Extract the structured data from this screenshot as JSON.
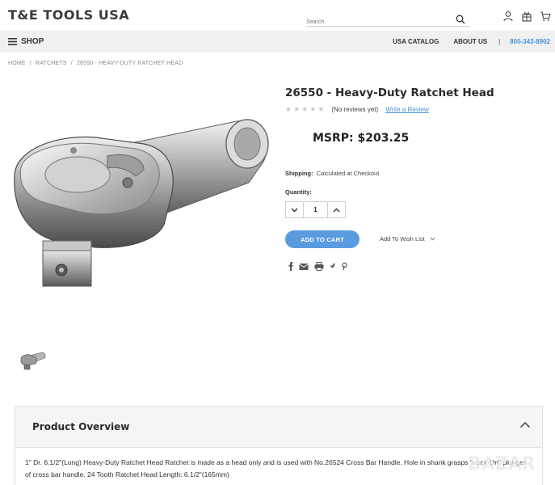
{
  "header": {
    "logo": "T&E TOOLS USA",
    "search_placeholder": "Search"
  },
  "icons": {
    "search": "search-icon",
    "account": "user-icon",
    "gift": "gift-icon",
    "cart": "cart-icon",
    "menu": "hamburger-icon"
  },
  "nav": {
    "shop_label": "SHOP",
    "links": [
      "USA CATALOG",
      "ABOUT US"
    ],
    "separator": "|",
    "phone": "800-343-8902"
  },
  "breadcrumb": [
    "HOME",
    "RATCHETS",
    "26550 - HEAVY-DUTY RATCHET HEAD"
  ],
  "breadcrumb_sep": "/",
  "product": {
    "title": "26550 - Heavy-Duty Ratchet Head",
    "reviews_text": "(No reviews yet)",
    "write_review": "Write a Review",
    "msrp": "MSRP: $203.25",
    "shipping_label": "Shipping:",
    "shipping_value": "Calculated at Checkout",
    "quantity_label": "Quantity:",
    "quantity_value": "1",
    "add_to_cart": "ADD TO CART",
    "wishlist": "Add To Wish List"
  },
  "overview": {
    "heading": "Product Overview",
    "description": "1\" Dr. 6.1/2\"(Long) Heavy-Duty Ratchet Head Ratchet is made as a head only and is used with No.26524 Cross Bar Handle. Hole in shank grasps \"Lock-On\" plunger of cross bar handle. 24 Tooth Ratchet Head Length: 6.1/2\"(165mm)"
  },
  "watermark": "BAZAR",
  "colors": {
    "accent": "#5a9be0",
    "link": "#4a90d9",
    "navbar_bg": "#f0f0f0"
  }
}
